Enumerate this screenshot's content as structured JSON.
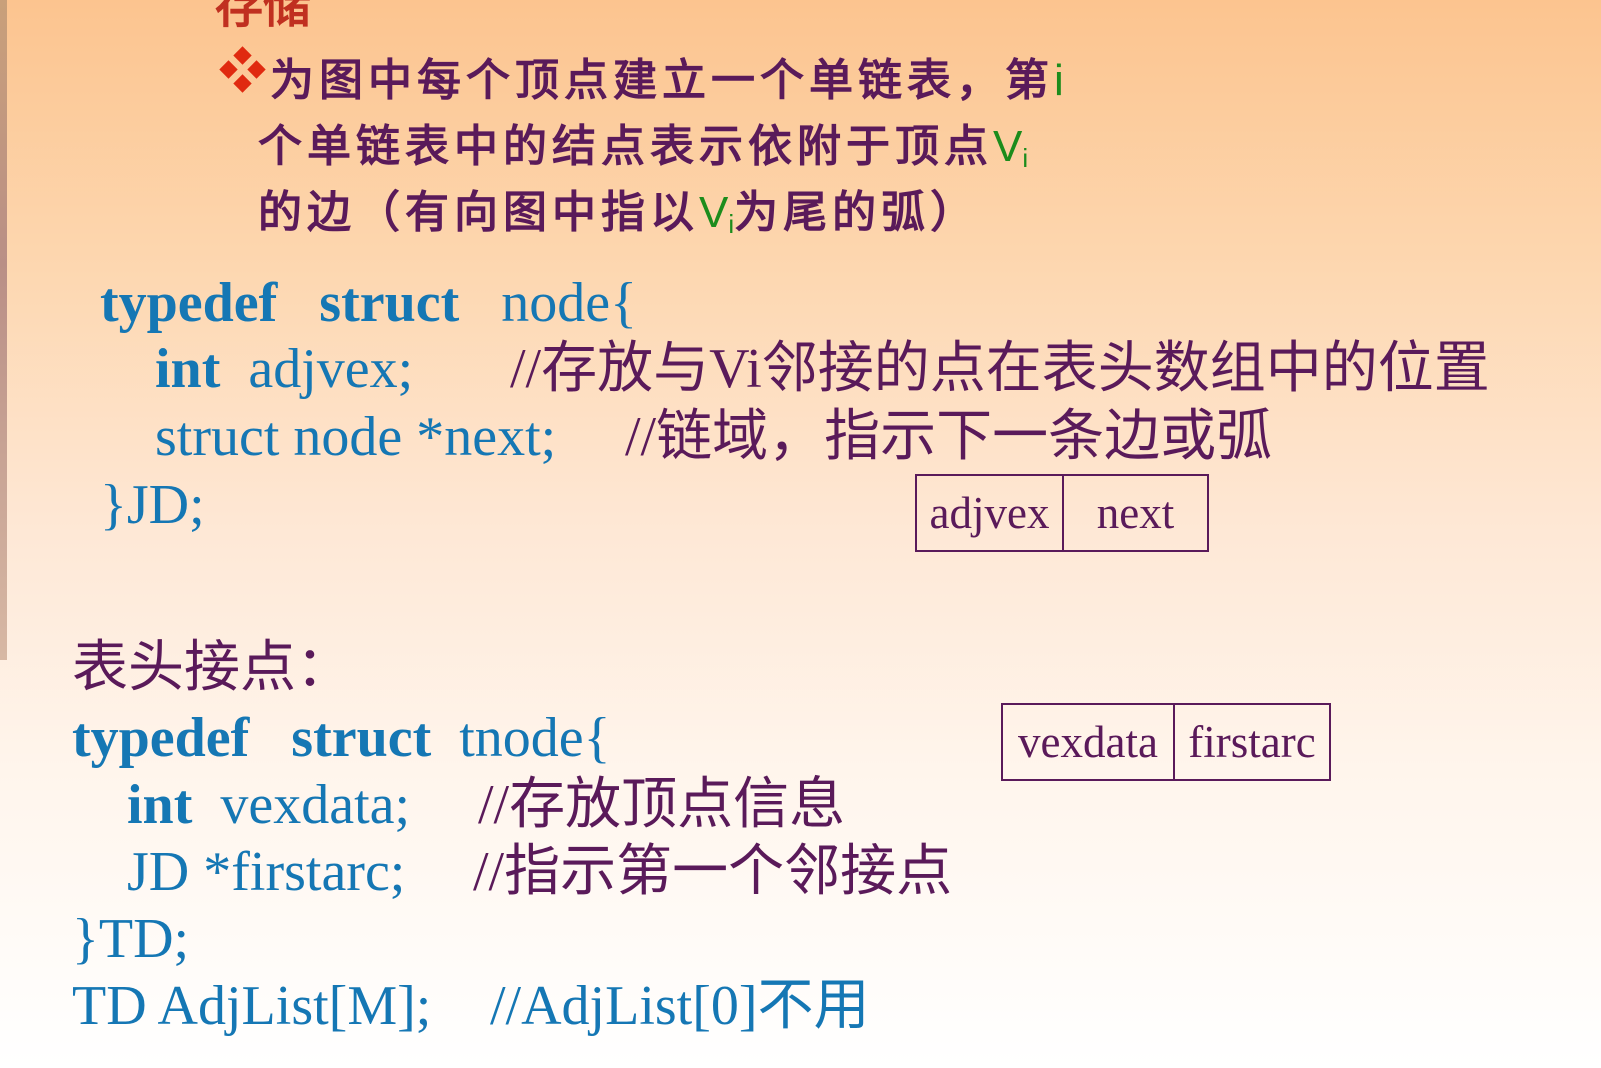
{
  "title_fragment": "存储",
  "bullet": {
    "line1": "为图中每个顶点建立一个单链表，第",
    "line1_var": "i",
    "line2": "个单链表中的结点表示依附于顶点",
    "line2_var": "V",
    "line2_sub": "i",
    "line3_a": "的边（有向图中指以",
    "line3_var": "V",
    "line3_sub": "i",
    "line3_b": "为尾的弧）"
  },
  "jd_struct": {
    "kw_typedef": "typedef",
    "kw_struct": "struct",
    "name": "node{",
    "kw_int": "int",
    "field1": "adjvex;",
    "comment1": "//存放与Vi邻接的点在表头数组中的位置",
    "field2": "struct  node  *next;",
    "comment2": "//链域，指示下一条边或弧",
    "close": "}JD;"
  },
  "jd_box": [
    "adjvex",
    "next"
  ],
  "header_label": "表头接点：",
  "td_struct": {
    "kw_typedef": "typedef",
    "kw_struct": "struct",
    "name": "tnode{",
    "kw_int": "int",
    "field1": "vexdata;",
    "comment1": "//存放顶点信息",
    "field2": "JD  *firstarc;",
    "comment2": "//指示第一个邻接点",
    "close": "}TD;",
    "decl": "TD   AdjList[M];",
    "decl_comment": "//AdjList[0]不用"
  },
  "td_box": [
    "vexdata",
    "firstarc"
  ],
  "colors": {
    "keyword": "#1577b4",
    "text": "#5a1a5a",
    "variable": "#1c8c1c",
    "bullet": "#e02a10"
  }
}
